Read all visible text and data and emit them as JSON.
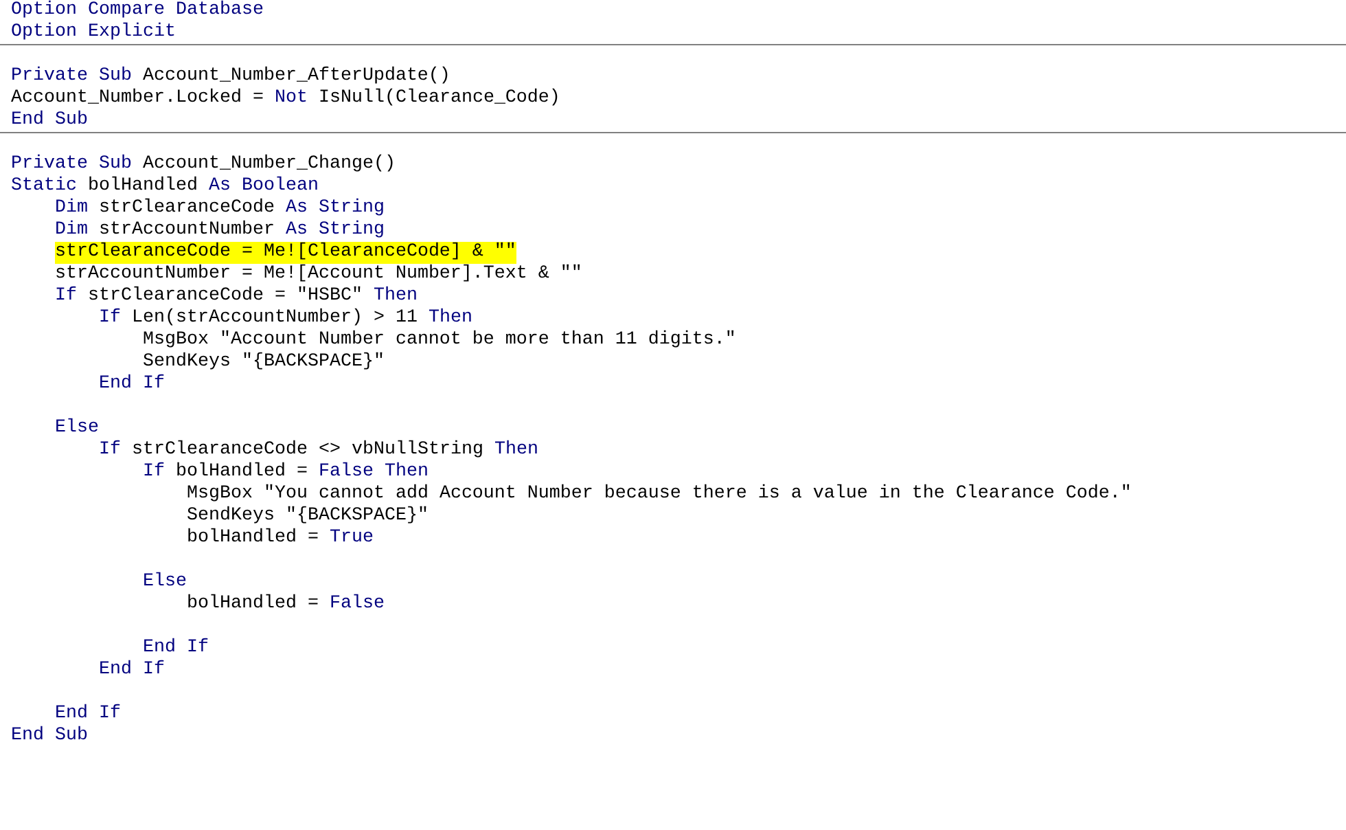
{
  "editor": {
    "sections": [
      {
        "lines": [
          {
            "kind": "code",
            "highlighted": false,
            "tokens": [
              {
                "kind": "keyword",
                "text": "Option Compare Database"
              }
            ]
          },
          {
            "kind": "code",
            "highlighted": false,
            "tokens": [
              {
                "kind": "keyword",
                "text": "Option Explicit"
              }
            ]
          }
        ]
      },
      {
        "lines": [
          {
            "kind": "blank"
          },
          {
            "kind": "code",
            "highlighted": false,
            "tokens": [
              {
                "kind": "keyword",
                "text": "Private Sub"
              },
              {
                "kind": "plain",
                "text": " Account_Number_AfterUpdate()"
              }
            ]
          },
          {
            "kind": "code",
            "highlighted": false,
            "tokens": [
              {
                "kind": "plain",
                "text": "Account_Number.Locked = "
              },
              {
                "kind": "keyword",
                "text": "Not"
              },
              {
                "kind": "plain",
                "text": " IsNull(Clearance_Code)"
              }
            ]
          },
          {
            "kind": "code",
            "highlighted": false,
            "tokens": [
              {
                "kind": "keyword",
                "text": "End Sub"
              }
            ]
          }
        ]
      },
      {
        "lines": [
          {
            "kind": "blank"
          },
          {
            "kind": "code",
            "highlighted": false,
            "tokens": [
              {
                "kind": "keyword",
                "text": "Private Sub"
              },
              {
                "kind": "plain",
                "text": " Account_Number_Change()"
              }
            ]
          },
          {
            "kind": "code",
            "highlighted": false,
            "tokens": [
              {
                "kind": "keyword",
                "text": "Static"
              },
              {
                "kind": "plain",
                "text": " bolHandled "
              },
              {
                "kind": "keyword",
                "text": "As Boolean"
              }
            ]
          },
          {
            "kind": "code",
            "highlighted": false,
            "tokens": [
              {
                "kind": "keyword",
                "text": "    Dim"
              },
              {
                "kind": "plain",
                "text": " strClearanceCode "
              },
              {
                "kind": "keyword",
                "text": "As String"
              }
            ]
          },
          {
            "kind": "code",
            "highlighted": false,
            "tokens": [
              {
                "kind": "keyword",
                "text": "    Dim"
              },
              {
                "kind": "plain",
                "text": " strAccountNumber "
              },
              {
                "kind": "keyword",
                "text": "As String"
              }
            ]
          },
          {
            "kind": "code",
            "highlighted": true,
            "tokens": [
              {
                "kind": "plain",
                "text": "    strClearanceCode = Me![ClearanceCode] & \"\""
              }
            ]
          },
          {
            "kind": "code",
            "highlighted": false,
            "tokens": [
              {
                "kind": "plain",
                "text": "    strAccountNumber = Me![Account Number].Text & \"\""
              }
            ]
          },
          {
            "kind": "code",
            "highlighted": false,
            "tokens": [
              {
                "kind": "keyword",
                "text": "    If"
              },
              {
                "kind": "plain",
                "text": " strClearanceCode = \"HSBC\" "
              },
              {
                "kind": "keyword",
                "text": "Then"
              }
            ]
          },
          {
            "kind": "code",
            "highlighted": false,
            "tokens": [
              {
                "kind": "keyword",
                "text": "        If"
              },
              {
                "kind": "plain",
                "text": " Len(strAccountNumber) > 11 "
              },
              {
                "kind": "keyword",
                "text": "Then"
              }
            ]
          },
          {
            "kind": "code",
            "highlighted": false,
            "tokens": [
              {
                "kind": "plain",
                "text": "            MsgBox \"Account Number cannot be more than 11 digits.\""
              }
            ]
          },
          {
            "kind": "code",
            "highlighted": false,
            "tokens": [
              {
                "kind": "plain",
                "text": "            SendKeys \"{BACKSPACE}\""
              }
            ]
          },
          {
            "kind": "code",
            "highlighted": false,
            "tokens": [
              {
                "kind": "keyword",
                "text": "        End If"
              }
            ]
          },
          {
            "kind": "blank"
          },
          {
            "kind": "code",
            "highlighted": false,
            "tokens": [
              {
                "kind": "keyword",
                "text": "    Else"
              }
            ]
          },
          {
            "kind": "code",
            "highlighted": false,
            "tokens": [
              {
                "kind": "keyword",
                "text": "        If"
              },
              {
                "kind": "plain",
                "text": " strClearanceCode <> vbNullString "
              },
              {
                "kind": "keyword",
                "text": "Then"
              }
            ]
          },
          {
            "kind": "code",
            "highlighted": false,
            "tokens": [
              {
                "kind": "keyword",
                "text": "            If"
              },
              {
                "kind": "plain",
                "text": " bolHandled = "
              },
              {
                "kind": "keyword",
                "text": "False Then"
              }
            ]
          },
          {
            "kind": "code",
            "highlighted": false,
            "tokens": [
              {
                "kind": "plain",
                "text": "                MsgBox \"You cannot add Account Number because there is a value in the Clearance Code.\""
              }
            ]
          },
          {
            "kind": "code",
            "highlighted": false,
            "tokens": [
              {
                "kind": "plain",
                "text": "                SendKeys \"{BACKSPACE}\""
              }
            ]
          },
          {
            "kind": "code",
            "highlighted": false,
            "tokens": [
              {
                "kind": "plain",
                "text": "                bolHandled = "
              },
              {
                "kind": "keyword",
                "text": "True"
              }
            ]
          },
          {
            "kind": "blank"
          },
          {
            "kind": "code",
            "highlighted": false,
            "tokens": [
              {
                "kind": "keyword",
                "text": "            Else"
              }
            ]
          },
          {
            "kind": "code",
            "highlighted": false,
            "tokens": [
              {
                "kind": "plain",
                "text": "                bolHandled = "
              },
              {
                "kind": "keyword",
                "text": "False"
              }
            ]
          },
          {
            "kind": "blank"
          },
          {
            "kind": "code",
            "highlighted": false,
            "tokens": [
              {
                "kind": "keyword",
                "text": "            End If"
              }
            ]
          },
          {
            "kind": "code",
            "highlighted": false,
            "tokens": [
              {
                "kind": "keyword",
                "text": "        End If"
              }
            ]
          },
          {
            "kind": "blank"
          },
          {
            "kind": "code",
            "highlighted": false,
            "tokens": [
              {
                "kind": "keyword",
                "text": "    End If"
              }
            ]
          },
          {
            "kind": "code",
            "highlighted": false,
            "tokens": [
              {
                "kind": "keyword",
                "text": "End Sub"
              }
            ]
          }
        ]
      }
    ]
  }
}
